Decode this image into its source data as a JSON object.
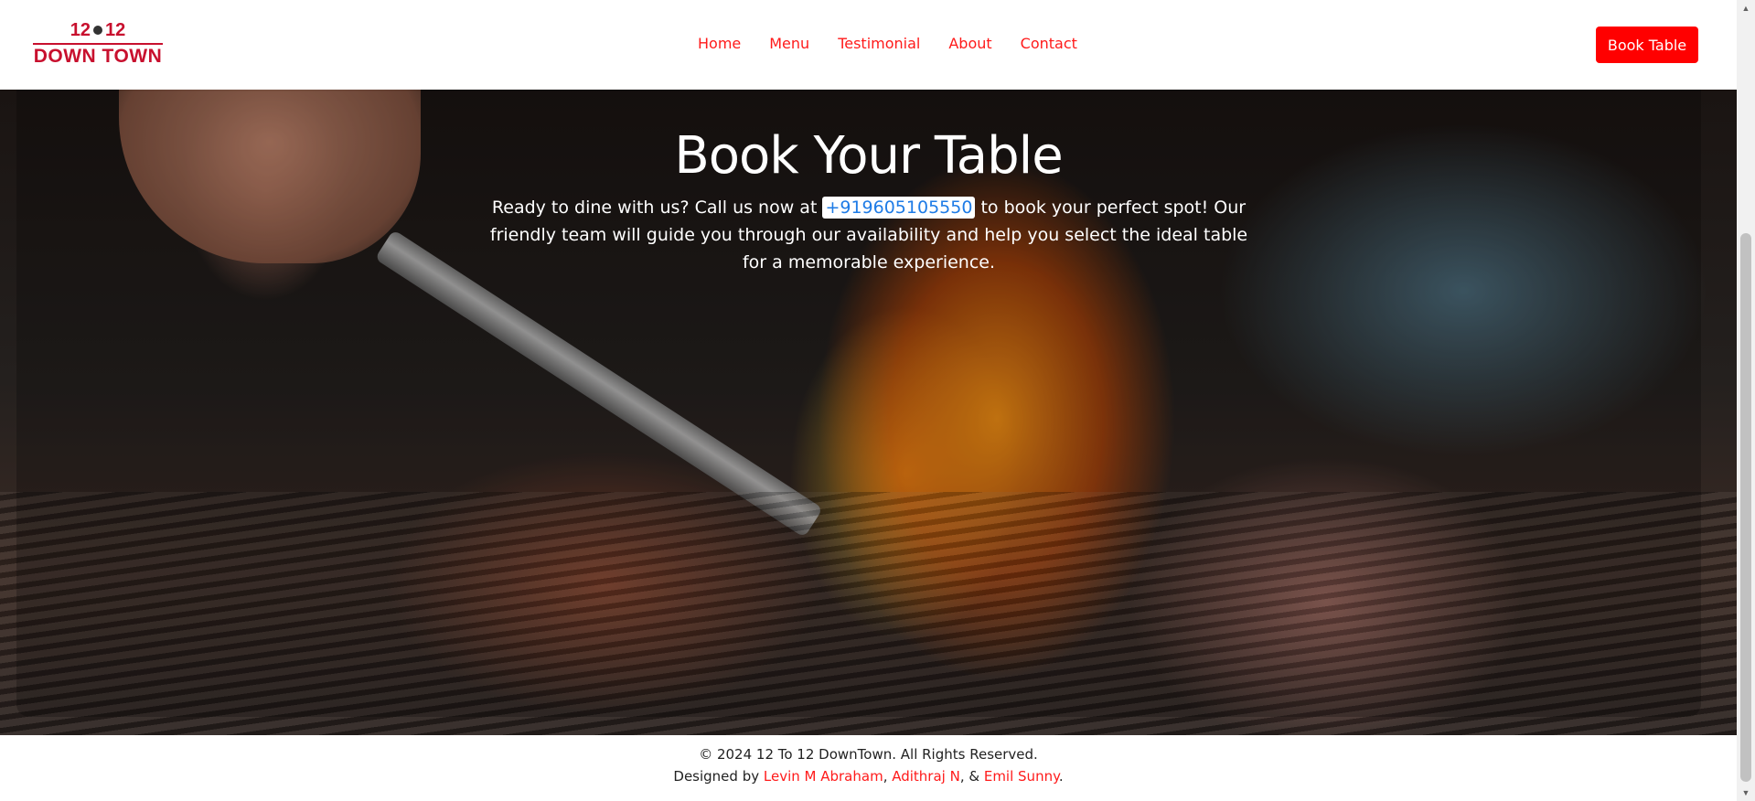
{
  "header": {
    "logo": {
      "top": "12",
      "bottom": "DOWN TOWN"
    },
    "nav": [
      "Home",
      "Menu",
      "Testimonial",
      "About",
      "Contact"
    ],
    "book_button": "Book Table"
  },
  "hero": {
    "title": "Book Your Table",
    "text_before": "Ready to dine with us? Call us now at ",
    "phone": "+919605105550",
    "text_after": " to book your perfect spot! Our friendly team will guide you through our availability and help you select the ideal table for a memorable experience."
  },
  "footer": {
    "copyright": "© 2024 12 To 12 DownTown. All Rights Reserved.",
    "designed_by": "Designed by ",
    "designer1": "Levin M Abraham",
    "sep1": ", ",
    "designer2": "Adithraj N",
    "sep2": ", & ",
    "designer3": "Emil Sunny",
    "end": "."
  },
  "icons": {
    "scroll_up": "▲",
    "scroll_down": "▼"
  },
  "colors": {
    "brand_red": "#ff0000",
    "logo_red": "#c8102e",
    "phone_link": "#1e7be6"
  }
}
